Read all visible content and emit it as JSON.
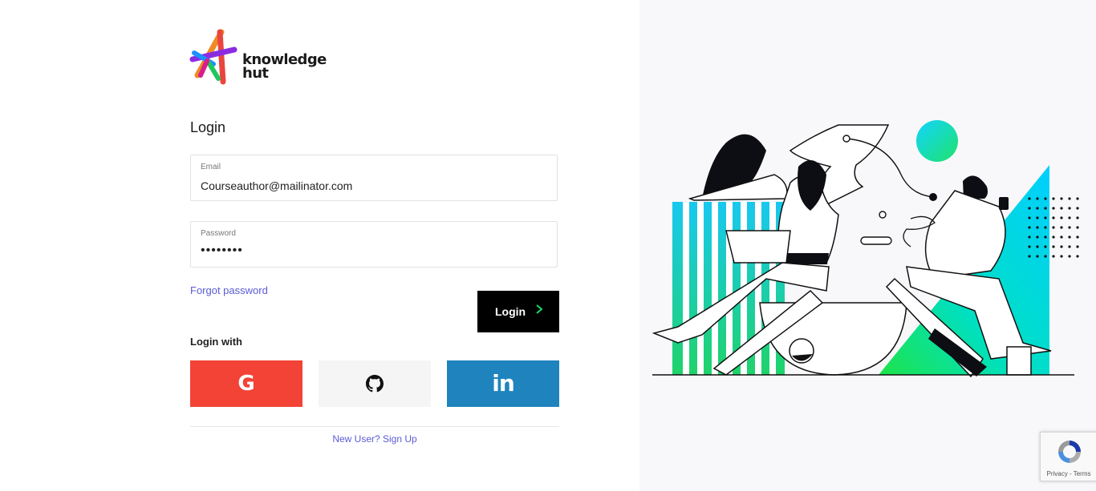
{
  "brand": {
    "name_line1": "knowledge",
    "name_line2": "hut",
    "logo_icon": "knowledgehut-star-logo"
  },
  "form": {
    "title": "Login",
    "email": {
      "label": "Email",
      "value": "Courseauthor@mailinator.com"
    },
    "password": {
      "label": "Password",
      "value": "••••••••"
    },
    "forgot_label": "Forgot password",
    "login_label": "Login",
    "login_icon": "chevron-right-icon"
  },
  "social": {
    "heading": "Login with",
    "providers": [
      {
        "name": "Google",
        "glyph": "G",
        "icon": "google-icon",
        "color": "#f24336"
      },
      {
        "name": "GitHub",
        "icon": "github-icon",
        "color": "#f5f5f5"
      },
      {
        "name": "LinkedIn",
        "glyph": "in",
        "icon": "linkedin-icon",
        "color": "#1f84be"
      }
    ]
  },
  "signup_label": "New User? Sign Up",
  "recaptcha": {
    "text": "Privacy - Terms",
    "icon": "recaptcha-icon"
  },
  "colors": {
    "accent_link": "#5b5bd6",
    "login_button": "#000000",
    "chevron": "#1ed760",
    "panel_bg": "#f8f8fa"
  }
}
